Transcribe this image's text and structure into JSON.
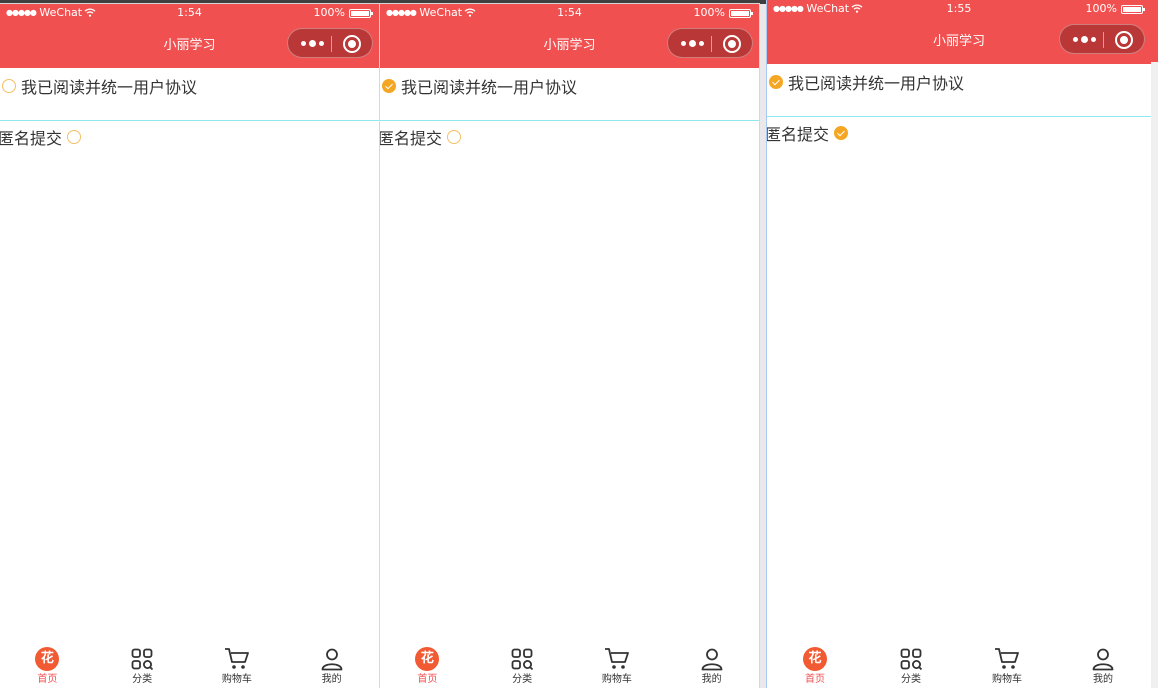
{
  "statusbar": {
    "carrier": "WeChat",
    "battery": "100%"
  },
  "times": [
    "1:54",
    "1:54",
    "1:55"
  ],
  "navbar": {
    "title": "小丽学习"
  },
  "form": {
    "agree_label": "我已阅读并统一用户协议",
    "anon_label": "匿名提交"
  },
  "states": [
    {
      "agree_checked": false,
      "anon_checked": false
    },
    {
      "agree_checked": true,
      "anon_checked": false
    },
    {
      "agree_checked": true,
      "anon_checked": true
    }
  ],
  "tabbar": {
    "home_glyph": "花",
    "items": [
      "首页",
      "分类",
      "购物车",
      "我的"
    ],
    "active_index": 0
  },
  "colors": {
    "brand": "#f15050",
    "check": "#f5a623",
    "divider": "#8ee8ee"
  }
}
